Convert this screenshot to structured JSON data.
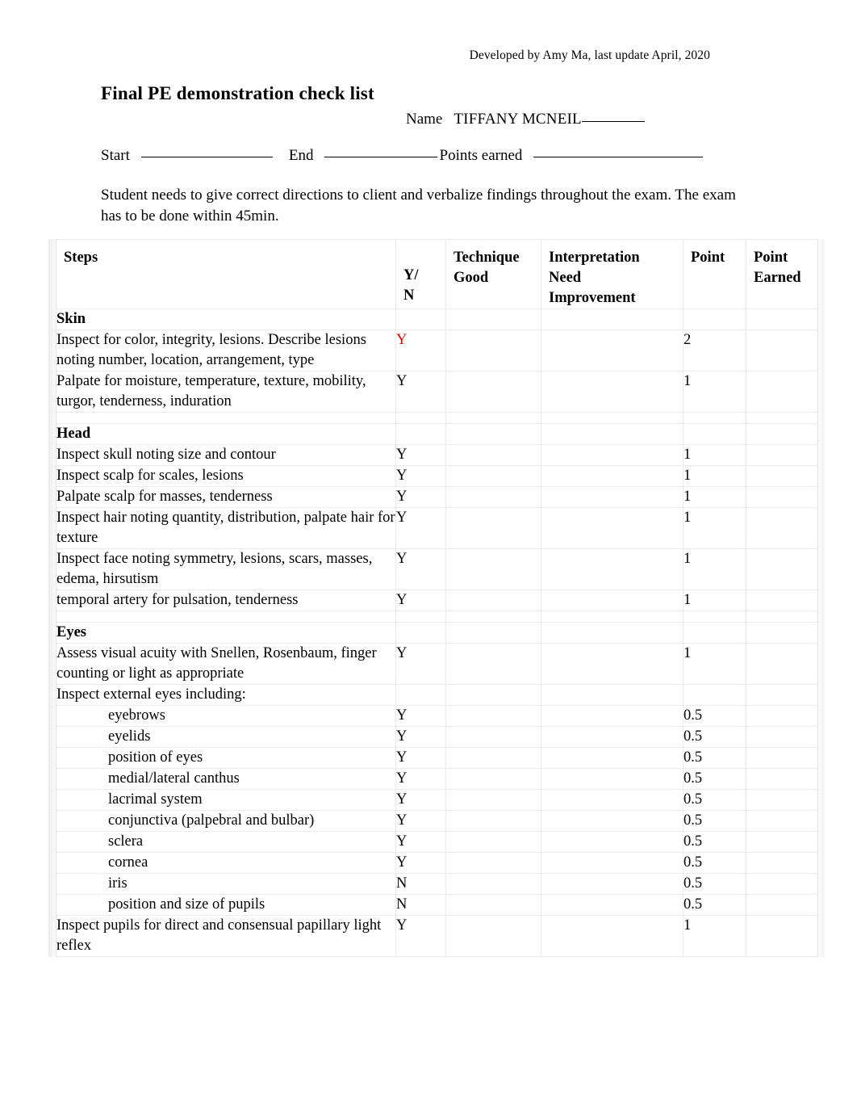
{
  "document": {
    "developed_by": "Developed by Amy Ma, last update April, 2020",
    "title": "Final PE demonstration check list",
    "name_label": "Name",
    "name_value": "TIFFANY MCNEIL",
    "start_label": "Start",
    "end_label": "End",
    "points_earned_label": "Points earned",
    "start_value": "",
    "end_value": "",
    "points_earned_value": "",
    "instructions": "Student needs to give correct directions to client and verbalize findings throughout the exam.  The exam has to be done within 45min."
  },
  "table": {
    "headers": {
      "steps": "Steps",
      "yn": "Y/\nN",
      "yn_line1": "Y/",
      "yn_line2": "N",
      "technique_line1": "Technique",
      "technique_line2": "Good",
      "interpretation_line1": "Interpretation",
      "interpretation_line2": "Need",
      "interpretation_line3": "Improvement",
      "point": "Point",
      "point_earned_line1": "Point",
      "point_earned_line2": "Earned"
    },
    "sections": [
      {
        "name": "Skin",
        "rows": [
          {
            "step": "Inspect for color, integrity, lesions.  Describe lesions noting number, location, arrangement, type",
            "yn": "Y",
            "yn_color": "#ee0000",
            "technique": "",
            "interpretation": "",
            "point": "2",
            "point_earned": "",
            "indent": false
          },
          {
            "step": "Palpate for moisture, temperature, texture, mobility, turgor, tenderness, induration",
            "yn": "Y",
            "yn_color": "#000000",
            "technique": "",
            "interpretation": "",
            "point": "1",
            "point_earned": "",
            "indent": false
          }
        ]
      },
      {
        "name": "Head",
        "rows": [
          {
            "step": "Inspect skull noting size and contour",
            "yn": "Y",
            "yn_color": "#000000",
            "technique": "",
            "interpretation": "",
            "point": "1",
            "point_earned": "",
            "indent": false
          },
          {
            "step": "Inspect scalp for scales, lesions",
            "yn": "Y",
            "yn_color": "#000000",
            "technique": "",
            "interpretation": "",
            "point": "1",
            "point_earned": "",
            "indent": false
          },
          {
            "step": "Palpate scalp for masses, tenderness",
            "yn": "Y",
            "yn_color": "#000000",
            "technique": "",
            "interpretation": "",
            "point": "1",
            "point_earned": "",
            "indent": false
          },
          {
            "step": "Inspect hair noting quantity, distribution, palpate hair for texture",
            "yn": "Y",
            "yn_color": "#000000",
            "technique": "",
            "interpretation": "",
            "point": "1",
            "point_earned": "",
            "indent": false
          },
          {
            "step": "Inspect face noting symmetry, lesions, scars, masses, edema, hirsutism",
            "yn": "Y",
            "yn_color": "#000000",
            "technique": "",
            "interpretation": "",
            "point": "1",
            "point_earned": "",
            "indent": false
          },
          {
            "step": "temporal artery for pulsation, tenderness",
            "yn": "Y",
            "yn_color": "#000000",
            "technique": "",
            "interpretation": "",
            "point": "1",
            "point_earned": "",
            "indent": false
          }
        ]
      },
      {
        "name": "Eyes",
        "rows": [
          {
            "step": "Assess visual acuity with Snellen, Rosenbaum, finger counting or light as appropriate",
            "yn": "Y",
            "yn_color": "#000000",
            "technique": "",
            "interpretation": "",
            "point": "1",
            "point_earned": "",
            "indent": false
          },
          {
            "step": "Inspect external eyes including:",
            "yn": "",
            "yn_color": "#000000",
            "technique": "",
            "interpretation": "",
            "point": "",
            "point_earned": "",
            "indent": false
          },
          {
            "step": "eyebrows",
            "yn": "Y",
            "yn_color": "#000000",
            "technique": "",
            "interpretation": "",
            "point": "0.5",
            "point_earned": "",
            "indent": true
          },
          {
            "step": "eyelids",
            "yn": "Y",
            "yn_color": "#000000",
            "technique": "",
            "interpretation": "",
            "point": "0.5",
            "point_earned": "",
            "indent": true
          },
          {
            "step": "position of eyes",
            "yn": "Y",
            "yn_color": "#000000",
            "technique": "",
            "interpretation": "",
            "point": "0.5",
            "point_earned": "",
            "indent": true
          },
          {
            "step": "medial/lateral canthus",
            "yn": "Y",
            "yn_color": "#000000",
            "technique": "",
            "interpretation": "",
            "point": "0.5",
            "point_earned": "",
            "indent": true
          },
          {
            "step": "lacrimal system",
            "yn": "Y",
            "yn_color": "#000000",
            "technique": "",
            "interpretation": "",
            "point": "0.5",
            "point_earned": "",
            "indent": true
          },
          {
            "step": "conjunctiva (palpebral and bulbar)",
            "yn": "Y",
            "yn_color": "#000000",
            "technique": "",
            "interpretation": "",
            "point": "0.5",
            "point_earned": "",
            "indent": true
          },
          {
            "step": "sclera",
            "yn": "Y",
            "yn_color": "#000000",
            "technique": "",
            "interpretation": "",
            "point": "0.5",
            "point_earned": "",
            "indent": true
          },
          {
            "step": "cornea",
            "yn": "Y",
            "yn_color": "#000000",
            "technique": "",
            "interpretation": "",
            "point": "0.5",
            "point_earned": "",
            "indent": true
          },
          {
            "step": "iris",
            "yn": "N",
            "yn_color": "#000000",
            "technique": "",
            "interpretation": "",
            "point": "0.5",
            "point_earned": "",
            "indent": true
          },
          {
            "step": "position and size of pupils",
            "yn": "N",
            "yn_color": "#000000",
            "technique": "",
            "interpretation": "",
            "point": "0.5",
            "point_earned": "",
            "indent": true
          },
          {
            "step": "Inspect pupils for direct and consensual papillary light reflex",
            "yn": "Y",
            "yn_color": "#000000",
            "technique": "",
            "interpretation": "",
            "point": "1",
            "point_earned": "",
            "indent": false
          }
        ]
      }
    ]
  }
}
